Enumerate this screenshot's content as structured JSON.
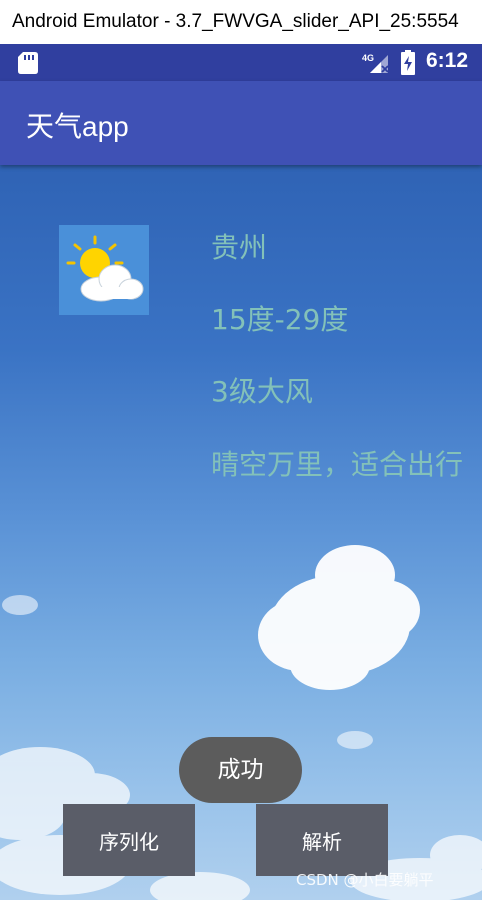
{
  "window": {
    "title": "Android Emulator - 3.7_FWVGA_slider_API_25:5554"
  },
  "status_bar": {
    "time": "6:12",
    "network": "4G",
    "background": "#303f9f"
  },
  "app_bar": {
    "title": "天气app",
    "background": "#3f51b5"
  },
  "weather": {
    "icon": "partly-cloudy-icon",
    "city": "贵州",
    "temperature": "15度-29度",
    "wind": "3级大风",
    "description": "晴空万里，适合出行",
    "text_color": "#83c1b9"
  },
  "toast": {
    "text": "成功"
  },
  "buttons": {
    "serialize": "序列化",
    "parse": "解析"
  },
  "watermark": "CSDN @小白要躺平"
}
